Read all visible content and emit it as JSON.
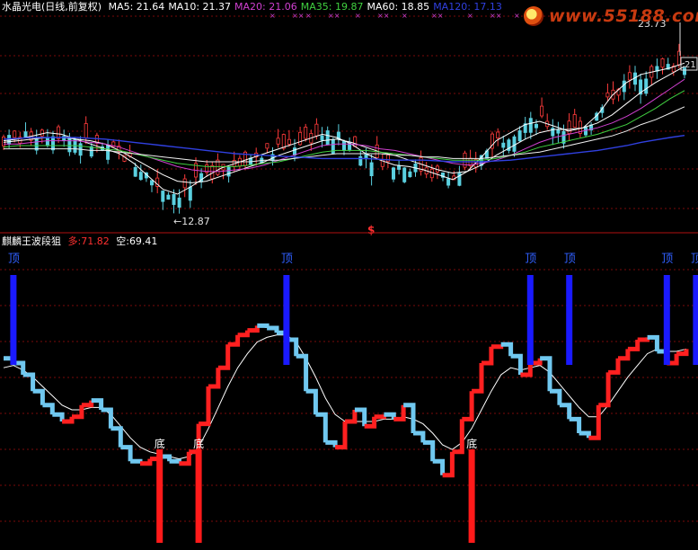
{
  "header_top": {
    "stock": "水晶光电(日线,前复权)",
    "ma": [
      {
        "label": "MA5: 21.64",
        "color": "#ffffff"
      },
      {
        "label": "MA10: 21.37",
        "color": "#ffffff"
      },
      {
        "label": "MA20: 21.06",
        "color": "#d040d0"
      },
      {
        "label": "MA35: 19.87",
        "color": "#40d040"
      },
      {
        "label": "MA60: 18.85",
        "color": "#ffffff"
      },
      {
        "label": "MA120: 17.13",
        "color": "#3040e0"
      }
    ]
  },
  "header_bottom": {
    "name": "麒麟王波段狙",
    "bull_label": "多:",
    "bull_value": "71.82",
    "bear_label": "空:",
    "bear_value": "69.41"
  },
  "watermark": "www.55188.com",
  "chart_data": [
    {
      "type": "candlestick",
      "title": "水晶光电(日线,前复权)",
      "ylim": [
        11.5,
        24.5
      ],
      "annotations": {
        "high": "23.73",
        "low": "12.87",
        "right_price": "21",
        "marker": "$"
      },
      "series": [
        {
          "name": "MA5",
          "color": "#ffffff",
          "values": [
            16.8,
            16.9,
            17.1,
            17.3,
            17.2,
            16.9,
            16.6,
            16.3,
            16.0,
            15.4,
            14.6,
            13.8,
            13.5,
            14.0,
            14.6,
            15.1,
            15.4,
            15.7,
            16.0,
            16.3,
            16.6,
            16.9,
            17.2,
            17.0,
            16.6,
            16.0,
            15.6,
            15.3,
            15.2,
            15.0,
            14.7,
            14.4,
            14.9,
            15.8,
            16.8,
            17.3,
            17.8,
            18.0,
            17.7,
            17.4,
            17.6,
            18.4,
            19.6,
            20.4,
            20.9,
            21.1,
            21.3,
            21.6
          ]
        },
        {
          "name": "MA10",
          "color": "#ffffff",
          "values": [
            16.7,
            16.8,
            16.9,
            17.0,
            17.0,
            16.9,
            16.8,
            16.6,
            16.2,
            15.7,
            15.2,
            14.7,
            14.3,
            14.2,
            14.3,
            14.6,
            14.9,
            15.2,
            15.5,
            15.9,
            16.2,
            16.5,
            16.8,
            16.9,
            16.7,
            16.4,
            16.1,
            15.9,
            15.6,
            15.3,
            15.0,
            14.8,
            14.9,
            15.3,
            15.9,
            16.4,
            16.9,
            17.3,
            17.5,
            17.5,
            17.6,
            17.9,
            18.4,
            19.1,
            19.8,
            20.4,
            20.9,
            21.4
          ]
        },
        {
          "name": "MA20",
          "color": "#d040d0",
          "values": [
            16.6,
            16.6,
            16.7,
            16.8,
            16.8,
            16.8,
            16.7,
            16.6,
            16.4,
            16.1,
            15.8,
            15.5,
            15.2,
            15.0,
            14.9,
            14.9,
            15.0,
            15.1,
            15.3,
            15.6,
            15.9,
            16.2,
            16.5,
            16.6,
            16.6,
            16.5,
            16.3,
            16.2,
            16.0,
            15.8,
            15.6,
            15.4,
            15.3,
            15.4,
            15.6,
            15.9,
            16.3,
            16.7,
            17.0,
            17.2,
            17.4,
            17.6,
            17.9,
            18.3,
            18.8,
            19.4,
            20.0,
            20.6
          ]
        },
        {
          "name": "MA35",
          "color": "#40d040",
          "values": [
            16.4,
            16.5,
            16.5,
            16.5,
            16.5,
            16.5,
            16.4,
            16.3,
            16.2,
            16.0,
            15.8,
            15.6,
            15.4,
            15.3,
            15.2,
            15.2,
            15.2,
            15.3,
            15.4,
            15.5,
            15.7,
            15.9,
            16.1,
            16.2,
            16.2,
            16.2,
            16.1,
            16.0,
            15.9,
            15.8,
            15.7,
            15.6,
            15.6,
            15.6,
            15.7,
            15.9,
            16.1,
            16.4,
            16.6,
            16.8,
            17.0,
            17.2,
            17.5,
            17.8,
            18.3,
            18.8,
            19.4,
            19.9
          ]
        },
        {
          "name": "MA60",
          "color": "#f0f0f0",
          "values": [
            16.3,
            16.3,
            16.3,
            16.3,
            16.3,
            16.3,
            16.2,
            16.2,
            16.1,
            16.0,
            15.9,
            15.8,
            15.7,
            15.6,
            15.5,
            15.5,
            15.5,
            15.5,
            15.6,
            15.6,
            15.7,
            15.8,
            15.9,
            16.0,
            16.0,
            16.0,
            16.0,
            15.9,
            15.9,
            15.8,
            15.8,
            15.7,
            15.7,
            15.7,
            15.8,
            15.9,
            16.0,
            16.1,
            16.3,
            16.5,
            16.7,
            16.9,
            17.1,
            17.4,
            17.8,
            18.1,
            18.5,
            18.9
          ]
        },
        {
          "name": "MA120",
          "color": "#3040e0",
          "values": [
            16.9,
            16.95,
            17.0,
            17.0,
            17.0,
            17.0,
            16.95,
            16.9,
            16.8,
            16.7,
            16.6,
            16.5,
            16.4,
            16.3,
            16.2,
            16.1,
            16.0,
            15.95,
            15.9,
            15.85,
            15.8,
            15.75,
            15.7,
            15.7,
            15.7,
            15.7,
            15.65,
            15.6,
            15.6,
            15.6,
            15.55,
            15.5,
            15.5,
            15.5,
            15.55,
            15.6,
            15.7,
            15.8,
            15.9,
            16.0,
            16.1,
            16.2,
            16.35,
            16.5,
            16.7,
            16.85,
            17.0,
            17.13
          ]
        }
      ]
    },
    {
      "type": "line",
      "title": "麒麟王波段狙",
      "ylim": [
        0,
        100
      ],
      "series": [
        {
          "name": "多",
          "color_up": "#ff2020",
          "color_down": "#70c8f0",
          "values": [
            62,
            60,
            55,
            48,
            42,
            38,
            35,
            37,
            42,
            44,
            40,
            32,
            24,
            18,
            17,
            19,
            20,
            18,
            17,
            22,
            34,
            50,
            58,
            68,
            72,
            74,
            76,
            75,
            73,
            70,
            63,
            48,
            38,
            26,
            24,
            35,
            40,
            33,
            37,
            38,
            36,
            42,
            30,
            26,
            18,
            12,
            22,
            36,
            48,
            60,
            67,
            68,
            63,
            55,
            60,
            62,
            48,
            42,
            36,
            30,
            28,
            42,
            56,
            62,
            66,
            70,
            71,
            65,
            60,
            64,
            66
          ]
        },
        {
          "name": "空",
          "color": "#ffffff",
          "values": [
            58,
            59,
            57,
            54,
            50,
            46,
            42,
            40,
            40,
            41,
            41,
            38,
            33,
            28,
            24,
            22,
            21,
            20,
            19,
            20,
            24,
            32,
            41,
            50,
            58,
            64,
            69,
            71,
            72,
            72,
            69,
            62,
            54,
            45,
            38,
            35,
            35,
            35,
            35,
            36,
            36,
            37,
            36,
            34,
            30,
            25,
            23,
            26,
            32,
            40,
            48,
            55,
            58,
            57,
            58,
            59,
            56,
            51,
            46,
            41,
            37,
            37,
            42,
            48,
            54,
            59,
            64,
            66,
            65,
            65,
            66
          ]
        }
      ],
      "top_labels": [
        "顶",
        "顶",
        "顶",
        "顶",
        "顶",
        "顶"
      ],
      "bottom_labels": [
        "底",
        "底",
        "底"
      ]
    }
  ]
}
